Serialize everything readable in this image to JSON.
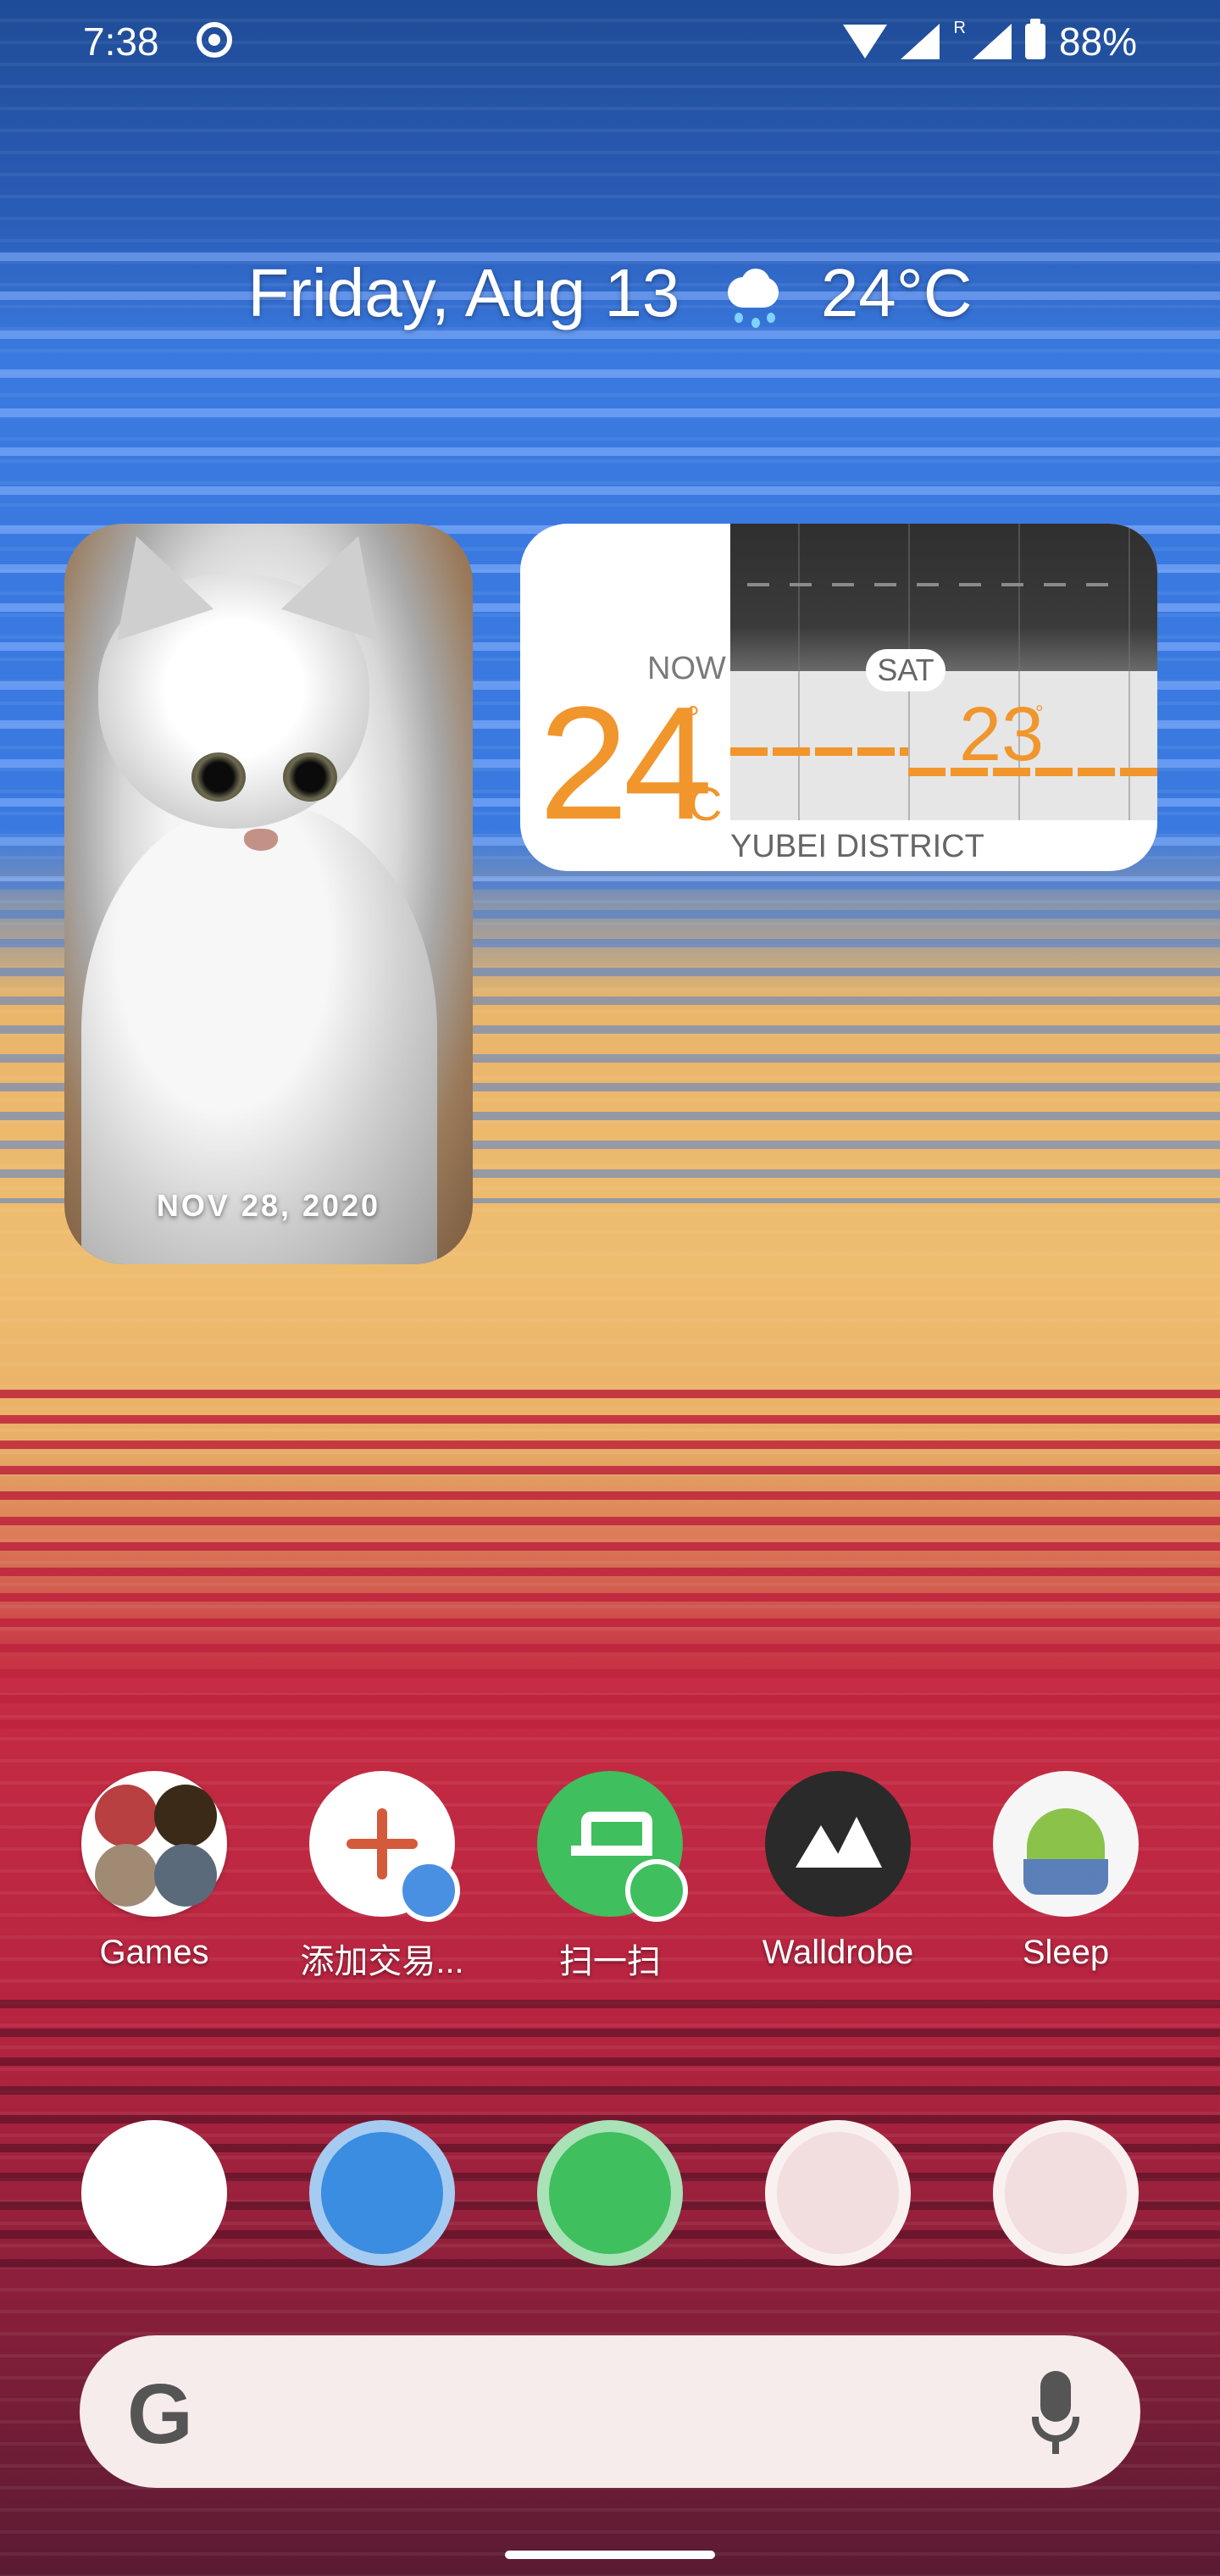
{
  "status_bar": {
    "time": "7:38",
    "battery": "88%",
    "network_tag": "R"
  },
  "glance": {
    "date": "Friday, Aug 13",
    "temp": "24°C",
    "weather_icon": "rain-cloud-icon"
  },
  "photo_widget": {
    "date": "NOV 28, 2020"
  },
  "weather_widget": {
    "now_label": "NOW",
    "current_temp": "24",
    "degree_symbol": "°",
    "unit": "C",
    "day_label": "SAT",
    "forecast_temp": "23",
    "location": "YUBEI DISTRICT"
  },
  "apps": [
    {
      "label": "Games",
      "icon": "games-folder-icon"
    },
    {
      "label": "添加交易...",
      "icon": "add-transaction-icon"
    },
    {
      "label": "扫一扫",
      "icon": "scan-icon"
    },
    {
      "label": "Walldrobe",
      "icon": "walldrobe-icon"
    },
    {
      "label": "Sleep",
      "icon": "sleep-icon"
    }
  ],
  "dock": [
    {
      "icon": "paper-plane-app-icon"
    },
    {
      "icon": "telegram-icon"
    },
    {
      "icon": "wechat-icon"
    },
    {
      "icon": "play-store-icon"
    },
    {
      "icon": "phone-icon"
    }
  ],
  "search_bar": {
    "logo": "G",
    "mic_icon": "microphone-icon"
  },
  "colors": {
    "accent_orange": "#f0962c",
    "wallpaper_blue": "#3a7ae0",
    "wallpaper_yellow": "#efbd70",
    "wallpaper_red": "#c62c43"
  }
}
